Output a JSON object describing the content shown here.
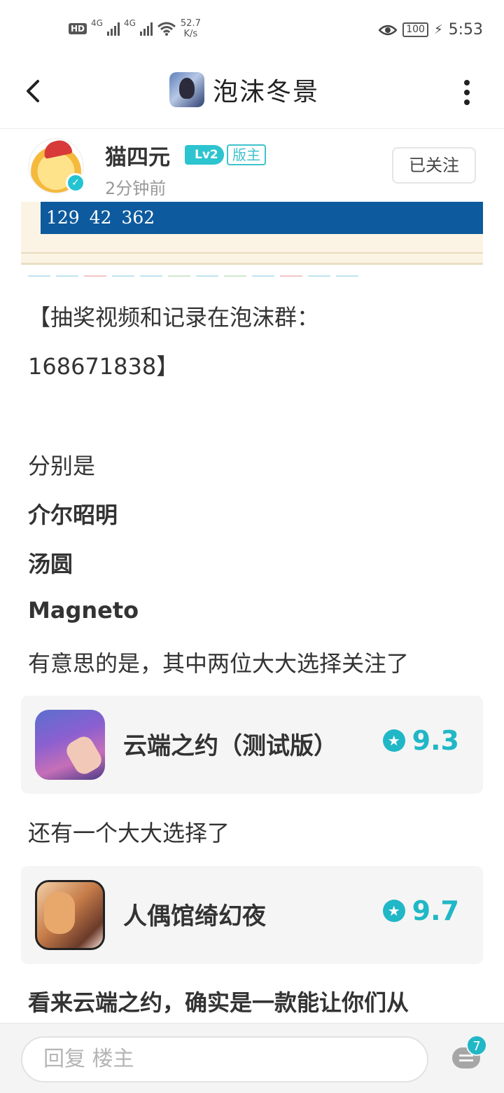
{
  "status_bar": {
    "hd": "HD",
    "net1": "4G",
    "net2": "4G",
    "speed_value": "52.7",
    "speed_unit": "K/s",
    "battery": "100",
    "time": "5:53"
  },
  "header": {
    "title": "泡沫冬景"
  },
  "post": {
    "author": "猫四元",
    "level": "Lv2",
    "role_badge": "版主",
    "time_ago": "2分钟前",
    "follow_label": "已关注",
    "image_numbers": "129  42  362",
    "lines": [
      "【抽奖视频和记录在泡沫群：",
      "168671838】",
      "分别是",
      "介尔昭明",
      "汤圆",
      "Magneto",
      "有意思的是，其中两位大大选择关注了",
      "还有一个大大选择了",
      "看来云端之约，确实是一款能让你们从"
    ],
    "apps": [
      {
        "name": "云端之约（测试版）",
        "rating": "9.3"
      },
      {
        "name": "人偶馆绮幻夜",
        "rating": "9.7"
      }
    ]
  },
  "bottom_bar": {
    "reply_placeholder": "回复  楼主",
    "comment_count": "7"
  },
  "colors": {
    "accent": "#20b7c6",
    "image_bar": "#0d5a9e"
  }
}
